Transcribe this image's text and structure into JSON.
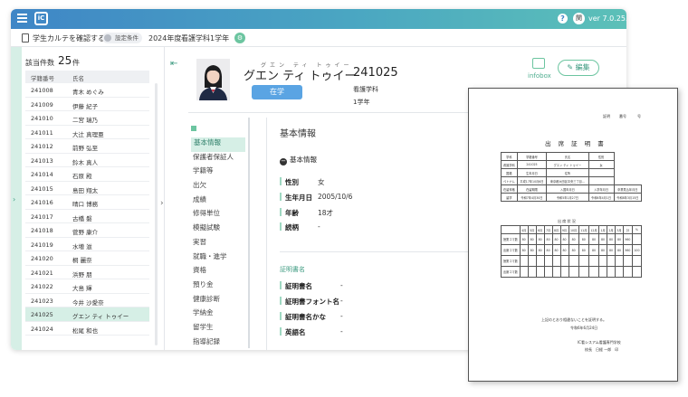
{
  "topbar": {
    "logo_text": "iC",
    "version": "ver 7.0.25.5",
    "help_label": "?",
    "user_label": "関",
    "colors": {
      "start": "#3f86c6",
      "end": "#5cc0b8"
    }
  },
  "breadcrumb": {
    "title": "学生カルテを確認する",
    "condition_label": "設定条件",
    "year": "2024年度",
    "department": "看護学科",
    "grade": "1学年"
  },
  "list": {
    "count_label": "該当件数",
    "count": "25",
    "count_unit": "件",
    "columns": [
      "学籍番号",
      "氏名"
    ],
    "rows": [
      {
        "id": "241008",
        "name": "青木 めぐみ"
      },
      {
        "id": "241009",
        "name": "伊藤 紀子"
      },
      {
        "id": "241010",
        "name": "二宮 瑞乃"
      },
      {
        "id": "241011",
        "name": "大辻 真理亜"
      },
      {
        "id": "241012",
        "name": "前野 弘至"
      },
      {
        "id": "241013",
        "name": "鈴木 真人"
      },
      {
        "id": "241014",
        "name": "石原 殿"
      },
      {
        "id": "241015",
        "name": "島田 翔太"
      },
      {
        "id": "241016",
        "name": "晴口 博務"
      },
      {
        "id": "241017",
        "name": "古橋 磐"
      },
      {
        "id": "241018",
        "name": "菅野 康介"
      },
      {
        "id": "241019",
        "name": "水増 滋"
      },
      {
        "id": "241020",
        "name": "桐 麗奈"
      },
      {
        "id": "241021",
        "name": "浜野 朋"
      },
      {
        "id": "241022",
        "name": "大島 輝"
      },
      {
        "id": "241023",
        "name": "今井 沙愛奈"
      },
      {
        "id": "241025",
        "name": "グエン ティ トゥイー"
      },
      {
        "id": "241024",
        "name": "松尾 和也"
      }
    ],
    "selected_index": 16
  },
  "student": {
    "furigana": "グエン ティ トゥイー",
    "name": "グエン ティ トゥイー",
    "id": "241025",
    "status": "在学",
    "department": "看護学科",
    "grade": "1学年",
    "infobox_label": "infobox",
    "edit_label": "編集"
  },
  "nav": {
    "items": [
      "基本情報",
      "保護者保証人",
      "学籍等",
      "出欠",
      "成績",
      "修得単位",
      "模擬試験",
      "実習",
      "就職・進学",
      "資格",
      "預り金",
      "健康診断",
      "学納金",
      "留学生",
      "指導記録"
    ],
    "active_index": 0
  },
  "basic_info": {
    "section_title": "基本情報",
    "sub_title": "基本情報",
    "fields": [
      {
        "label": "性別",
        "value": "女"
      },
      {
        "label": "生年月日",
        "value": "2005/10/6"
      },
      {
        "label": "年齢",
        "value": "18才"
      },
      {
        "label": "続柄",
        "value": "-"
      }
    ]
  },
  "certificate_info": {
    "heading": "証明書名",
    "fields": [
      {
        "label": "証明書名",
        "value": "-"
      },
      {
        "label": "証明書フォント名",
        "value": "-"
      },
      {
        "label": "証明書名かな",
        "value": "-"
      },
      {
        "label": "英語名",
        "value": "-"
      }
    ]
  },
  "document": {
    "top_labels": [
      "証明",
      "番号",
      "号"
    ],
    "title": "出 席 証 明 書",
    "info_rows": [
      [
        "学科",
        "学籍番号",
        "氏名",
        "性別"
      ],
      [
        "看護学科",
        "241025",
        "グエン ティ トゥイー",
        "女"
      ],
      [
        "国籍",
        "生年月日",
        "住所",
        ""
      ],
      [
        "ベトナム",
        "平成17年10月6日",
        "東京都大田区中央三丁目…",
        ""
      ],
      [
        "在留資格",
        "在留期限",
        "入国年月日",
        "入学年月日",
        "卒業見込年月日"
      ],
      [
        "留学",
        "令和7年4月30日",
        "令和5年1月27日",
        "令和6年4月1日",
        "令和8年3月15日"
      ]
    ],
    "attendance_title": "出 席 状 況",
    "months": [
      "4月",
      "5月",
      "6月",
      "7月",
      "8月",
      "9月",
      "10月",
      "11月",
      "12月",
      "1月",
      "2月",
      "3月",
      "計",
      "%"
    ],
    "attendance_rows": [
      {
        "label": "授業コマ数",
        "values": [
          "80",
          "80",
          "80",
          "80",
          "80",
          "80",
          "80",
          "80",
          "80",
          "80",
          "80",
          "80",
          "960",
          ""
        ]
      },
      {
        "label": "出席コマ数",
        "values": [
          "80",
          "80",
          "80",
          "80",
          "80",
          "80",
          "80",
          "80",
          "80",
          "80",
          "80",
          "80",
          "960",
          "100"
        ]
      },
      {
        "label": "授業コマ数",
        "values": [
          "",
          "",
          "",
          "",
          "",
          "",
          "",
          "",
          "",
          "",
          "",
          "",
          "",
          ""
        ]
      },
      {
        "label": "出席コマ数",
        "values": [
          "",
          "",
          "",
          "",
          "",
          "",
          "",
          "",
          "",
          "",
          "",
          "",
          "",
          ""
        ]
      }
    ],
    "statement": "上記のとおり相違ないことを証明する。",
    "date": "令和6年6月24日",
    "school": "IC看シスアム看護専門学校",
    "principal": "校長　日経 一郎　印"
  }
}
